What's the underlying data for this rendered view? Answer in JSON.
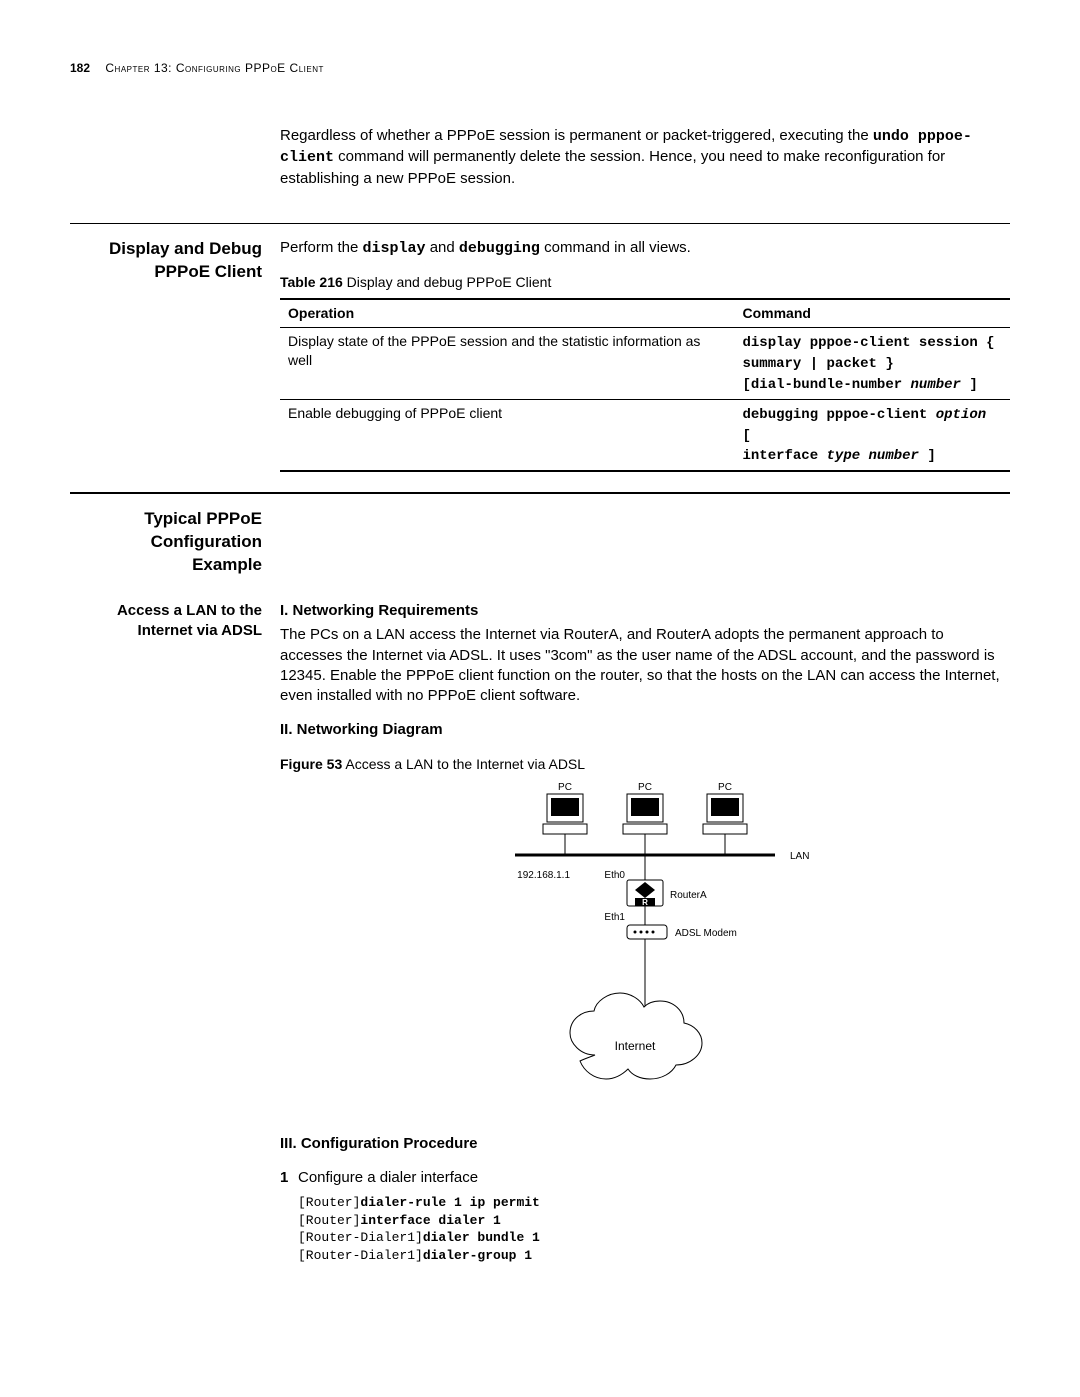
{
  "header": {
    "page_number": "182",
    "chapter_run": "Chapter 13: Configuring PPPoE Client"
  },
  "intro_para": {
    "p1a": "Regardless of whether a PPPoE session is permanent or packet-triggered, executing the ",
    "code1": "undo pppoe-client",
    "p1b": " command will permanently delete the session. Hence, you need to make reconfiguration for establishing a new PPPoE session."
  },
  "section1": {
    "heading_l1": "Display and Debug",
    "heading_l2": "PPPoE Client",
    "intro_a": "Perform the ",
    "intro_code1": "display",
    "intro_mid": " and ",
    "intro_code2": "debugging",
    "intro_b": " command in all views.",
    "table_caption_b": "Table 216",
    "table_caption_rest": "   Display and debug PPPoE Client",
    "th1": "Operation",
    "th2": "Command",
    "r1c1": "Display state of the PPPoE session and the statistic information as well",
    "r1c2_l1a": "display pppoe-client session {",
    "r1c2_l2a": "summary | packet }",
    "r1c2_l3a": "[dial-bundle-number ",
    "r1c2_l3i": "number",
    "r1c2_l3b": " ]",
    "r2c1": "Enable debugging of PPPoE client",
    "r2c2_l1a": "debugging pppoe-client ",
    "r2c2_l1i": "option",
    "r2c2_l1b": " [",
    "r2c2_l2a": "interface ",
    "r2c2_l2i": "type number",
    "r2c2_l2b": " ]"
  },
  "section2": {
    "heading_l1": "Typical PPPoE",
    "heading_l2": "Configuration",
    "heading_l3": "Example"
  },
  "section3": {
    "sub_l1": "Access a LAN to the",
    "sub_l2": "Internet via ADSL",
    "h1": "I. Networking Requirements",
    "body": "The PCs on a LAN access the Internet via RouterA, and RouterA adopts the permanent approach to accesses the Internet via ADSL. It uses \"3com\" as the user name of the ADSL account, and the password is 12345. Enable the PPPoE client function on the router, so that the hosts on the LAN can access the Internet, even installed with no PPPoE client software.",
    "h2": "II. Networking Diagram",
    "fig_caption_b": "Figure 53",
    "fig_caption_rest": "   Access a LAN to the Internet via ADSL",
    "diagram": {
      "pc1": "PC",
      "pc2": "PC",
      "pc3": "PC",
      "lan": "LAN",
      "ip": "192.168.1.1",
      "eth0": "Eth0",
      "routerA": "RouterA",
      "R": "R",
      "eth1": "Eth1",
      "adsl": "ADSL Modem",
      "internet": "Internet"
    },
    "h3": "III. Configuration Procedure",
    "step1_num": "1",
    "step1_text": "Configure a dialer interface",
    "code": {
      "l1p": "[Router]",
      "l1b": "dialer-rule 1 ip permit",
      "l2p": "[Router]",
      "l2b": "interface dialer 1",
      "l3p": "[Router-Dialer1]",
      "l3b": "dialer bundle 1",
      "l4p": "[Router-Dialer1]",
      "l4b": "dialer-group 1"
    }
  }
}
